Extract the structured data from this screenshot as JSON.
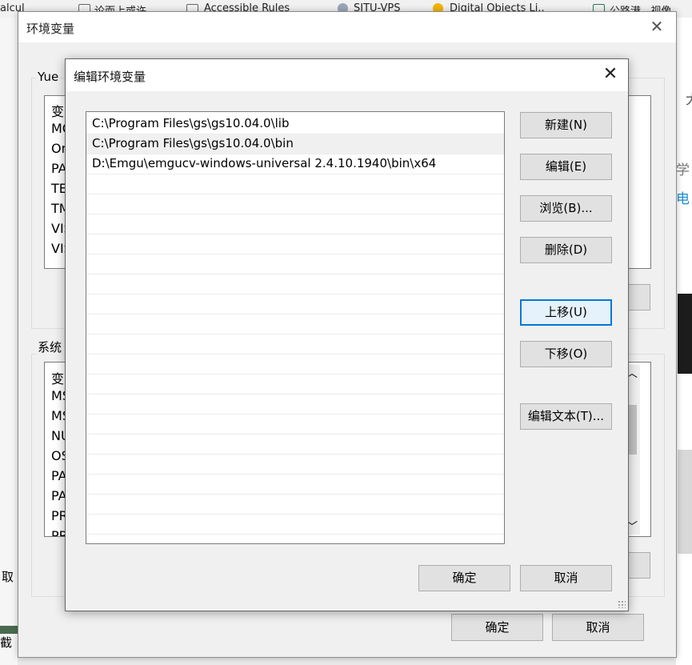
{
  "background": {
    "bookmarks": [
      "alcul",
      "论而上或许",
      "Accessible Rules",
      "SJTU-VPS",
      "Digital Objects Li..",
      "公路港...视像"
    ],
    "right_fragments": [
      "大",
      "学",
      "电"
    ],
    "left_fragment": "取",
    "bottom_left_fragment": "截"
  },
  "outer_window": {
    "title": "环境变量",
    "close_glyph": "✕",
    "user_group_label": "Yue",
    "user_vars": [
      "变",
      "MC",
      "On",
      "PA",
      "TE",
      "TM",
      "VIS",
      "VIS"
    ],
    "system_group_label": "系统",
    "system_vars": [
      "变",
      "MS",
      "MS",
      "NU",
      "OS",
      "PA",
      "PA",
      "PR",
      "PR"
    ],
    "ok_label": "确定",
    "cancel_label": "取消",
    "scroll_up": "︿",
    "scroll_down": "﹀"
  },
  "edit_dialog": {
    "title": "编辑环境变量",
    "close_glyph": "✕",
    "paths": [
      "C:\\Program Files\\gs\\gs10.04.0\\lib",
      "C:\\Program Files\\gs\\gs10.04.0\\bin",
      "D:\\Emgu\\emgucv-windows-universal 2.4.10.1940\\bin\\x64"
    ],
    "selected_index": 1,
    "buttons": {
      "new": "新建(N)",
      "edit": "编辑(E)",
      "browse": "浏览(B)...",
      "delete": "删除(D)",
      "move_up": "上移(U)",
      "move_down": "下移(O)",
      "edit_text": "编辑文本(T)..."
    },
    "ok_label": "确定",
    "cancel_label": "取消"
  },
  "colors": {
    "focus_border": "#0078d7",
    "button_face": "#e1e1e1",
    "dialog_bg": "#f0f0f0"
  }
}
